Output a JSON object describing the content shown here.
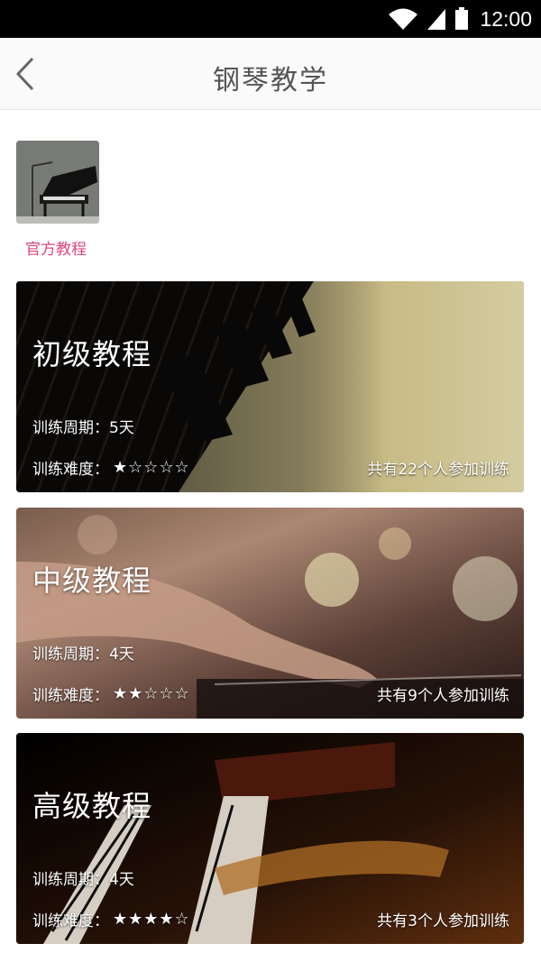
{
  "status_bar": {
    "time": "12:00",
    "icons": [
      "wifi-icon",
      "signal-icon",
      "battery-icon"
    ]
  },
  "header": {
    "title": "钢琴教学",
    "back_icon": "back-arrow-icon"
  },
  "categories": [
    {
      "label": "官方教程",
      "thumb_icon": "piano-image"
    }
  ],
  "courses": [
    {
      "name": "初级教程",
      "period": "训练周期：5天",
      "difficulty_label": "训练难度：",
      "difficulty": "★☆☆☆☆",
      "difficulty_value": 1,
      "participants": "共有22个人参加训练"
    },
    {
      "name": "中级教程",
      "period": "训练周期：4天",
      "difficulty_label": "训练难度：",
      "difficulty": "★★☆☆☆",
      "difficulty_value": 2,
      "participants": "共有9个人参加训练"
    },
    {
      "name": "高级教程",
      "period": "训练周期：4天",
      "difficulty_label": "训练难度：",
      "difficulty": "★★★★☆",
      "difficulty_value": 4,
      "participants": "共有3个人参加训练"
    }
  ],
  "colors": {
    "category_label": "#e0457b",
    "title": "#555555"
  }
}
